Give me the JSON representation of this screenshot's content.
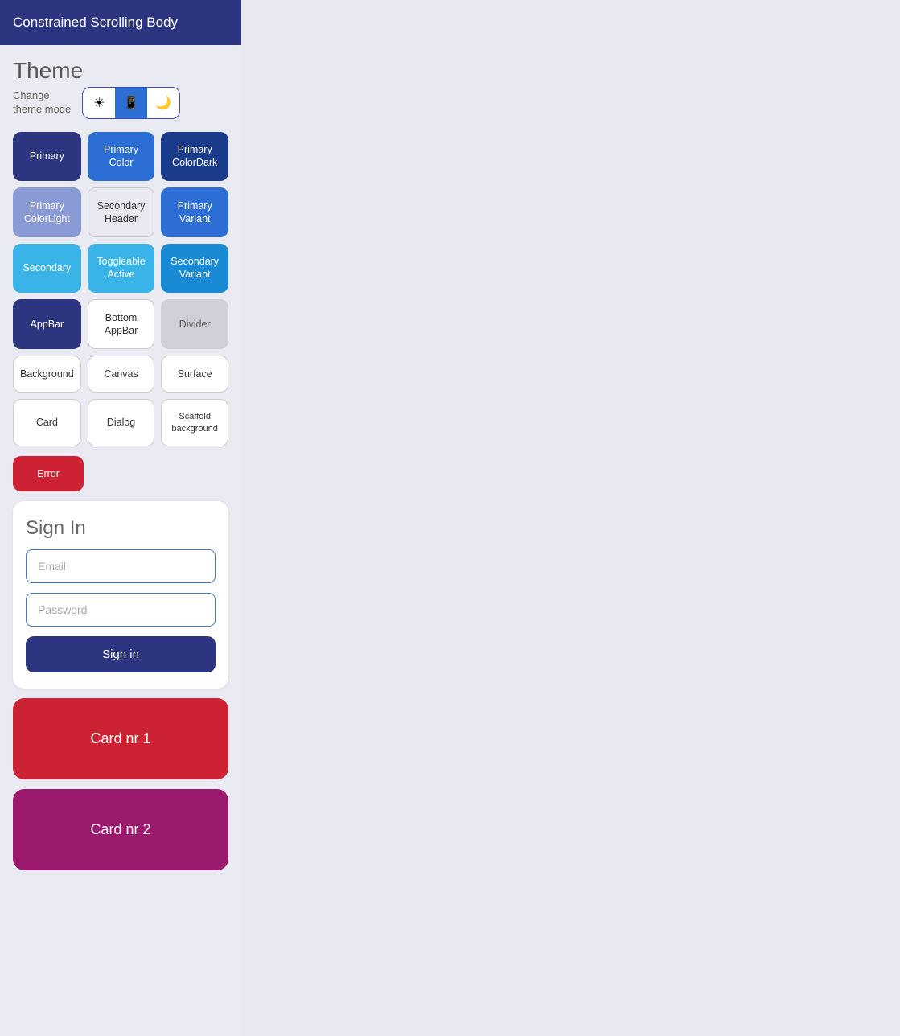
{
  "header": {
    "title": "Constrained Scrolling Body"
  },
  "theme": {
    "section_title": "Theme",
    "mode_label": "Change\ntheme mode",
    "toggle_buttons": [
      {
        "icon": "☀",
        "label": "light-mode",
        "active": false
      },
      {
        "icon": "📱",
        "label": "mobile-mode",
        "active": true
      },
      {
        "icon": "🌙",
        "label": "dark-mode",
        "active": false
      }
    ]
  },
  "color_buttons": [
    {
      "label": "Primary",
      "class": "btn-primary"
    },
    {
      "label": "Primary Color",
      "class": "btn-primary-color"
    },
    {
      "label": "Primary ColorDark",
      "class": "btn-primary-colordark"
    },
    {
      "label": "Primary ColorLight",
      "class": "btn-primary-colorlight"
    },
    {
      "label": "Secondary Header",
      "class": "btn-secondary-header"
    },
    {
      "label": "Primary Variant",
      "class": "btn-primary-variant"
    },
    {
      "label": "Secondary",
      "class": "btn-secondary"
    },
    {
      "label": "Toggleable Active",
      "class": "btn-toggleable-active"
    },
    {
      "label": "Secondary Variant",
      "class": "btn-secondary-variant"
    },
    {
      "label": "AppBar",
      "class": "btn-appbar"
    },
    {
      "label": "Bottom AppBar",
      "class": "btn-bottom-appbar"
    },
    {
      "label": "Divider",
      "class": "btn-divider"
    },
    {
      "label": "Background",
      "class": "btn-background"
    },
    {
      "label": "Canvas",
      "class": "btn-canvas"
    },
    {
      "label": "Surface",
      "class": "btn-surface"
    },
    {
      "label": "Card",
      "class": "btn-card"
    },
    {
      "label": "Dialog",
      "class": "btn-dialog"
    },
    {
      "label": "Scaffold background",
      "class": "btn-scaffold"
    }
  ],
  "error_button": {
    "label": "Error"
  },
  "sign_in": {
    "title": "Sign In",
    "email_placeholder": "Email",
    "password_placeholder": "Password",
    "button_label": "Sign in"
  },
  "cards": [
    {
      "label": "Card nr 1",
      "style": "card-nr1"
    },
    {
      "label": "Card nr 2",
      "style": "card-nr2"
    }
  ]
}
